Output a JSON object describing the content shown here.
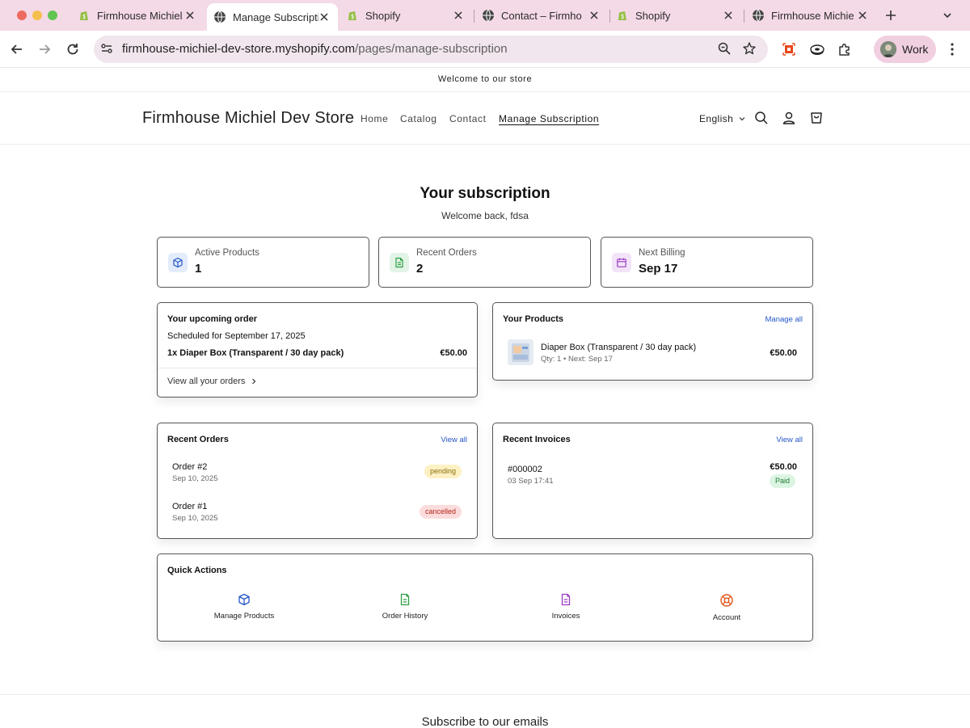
{
  "browser": {
    "tabs": [
      {
        "title": "Firmhouse Michiel",
        "favicon": "shopify-icon"
      },
      {
        "title": "Manage Subscripti",
        "favicon": "globe-icon"
      },
      {
        "title": "Shopify",
        "favicon": "shopify-icon"
      },
      {
        "title": "Contact – Firmho",
        "favicon": "globe-icon"
      },
      {
        "title": "Shopify",
        "favicon": "shopify-icon"
      },
      {
        "title": "Firmhouse Michie",
        "favicon": "globe-icon"
      }
    ],
    "url_host": "firmhouse-michiel-dev-store.myshopify.com",
    "url_path": "/pages/manage-subscription",
    "profile_label": "Work",
    "colors": {
      "tabbar": "#f4d9e6",
      "omnibox": "#f2e6ee",
      "profile": "#f0cfe0"
    }
  },
  "store": {
    "announcement": "Welcome to our store",
    "name": "Firmhouse Michiel Dev Store",
    "nav": [
      "Home",
      "Catalog",
      "Contact",
      "Manage Subscription"
    ],
    "language": "English"
  },
  "page": {
    "title": "Your subscription",
    "welcome": "Welcome back, fdsa",
    "stats": [
      {
        "label": "Active Products",
        "value": "1",
        "icon": "box-icon",
        "color": "#2457c5",
        "bg": "#e3ecfb"
      },
      {
        "label": "Recent Orders",
        "value": "2",
        "icon": "document-icon",
        "color": "#2f9e44",
        "bg": "#e2f4e6"
      },
      {
        "label": "Next Billing",
        "value": "Sep 17",
        "icon": "calendar-icon",
        "color": "#9b3bc4",
        "bg": "#f3e3f9"
      }
    ],
    "upcoming": {
      "title": "Your upcoming order",
      "scheduled": "Scheduled for September 17, 2025",
      "item": "1x Diaper Box (Transparent / 30 day pack)",
      "price": "€50.00",
      "link": "View all your orders"
    },
    "products": {
      "title": "Your Products",
      "link": "Manage all",
      "items": [
        {
          "name": "Diaper Box (Transparent / 30 day pack)",
          "meta": "Qty: 1 • Next: Sep 17",
          "price": "€50.00"
        }
      ]
    },
    "orders": {
      "title": "Recent Orders",
      "link": "View all",
      "items": [
        {
          "name": "Order #2",
          "date": "Sep 10, 2025",
          "status": "pending",
          "status_color": "#8a6d0b",
          "status_bg": "#fdf1c4"
        },
        {
          "name": "Order #1",
          "date": "Sep 10, 2025",
          "status": "cancelled",
          "status_color": "#b42318",
          "status_bg": "#fbdcdc"
        }
      ]
    },
    "invoices": {
      "title": "Recent Invoices",
      "link": "View all",
      "items": [
        {
          "number": "#000002",
          "date": "03 Sep 17:41",
          "amount": "€50.00",
          "status": "Paid",
          "status_color": "#1f7a35",
          "status_bg": "#dcf5e3"
        }
      ]
    },
    "quick_actions": {
      "title": "Quick Actions",
      "items": [
        {
          "label": "Manage Products",
          "icon": "box-icon",
          "color": "#2457c5"
        },
        {
          "label": "Order History",
          "icon": "document-icon",
          "color": "#2f9e44"
        },
        {
          "label": "Invoices",
          "icon": "document-icon",
          "color": "#9b3bc4"
        },
        {
          "label": "Account",
          "icon": "lifebuoy-icon",
          "color": "#e2571c"
        }
      ]
    },
    "footer_heading": "Subscribe to our emails"
  }
}
